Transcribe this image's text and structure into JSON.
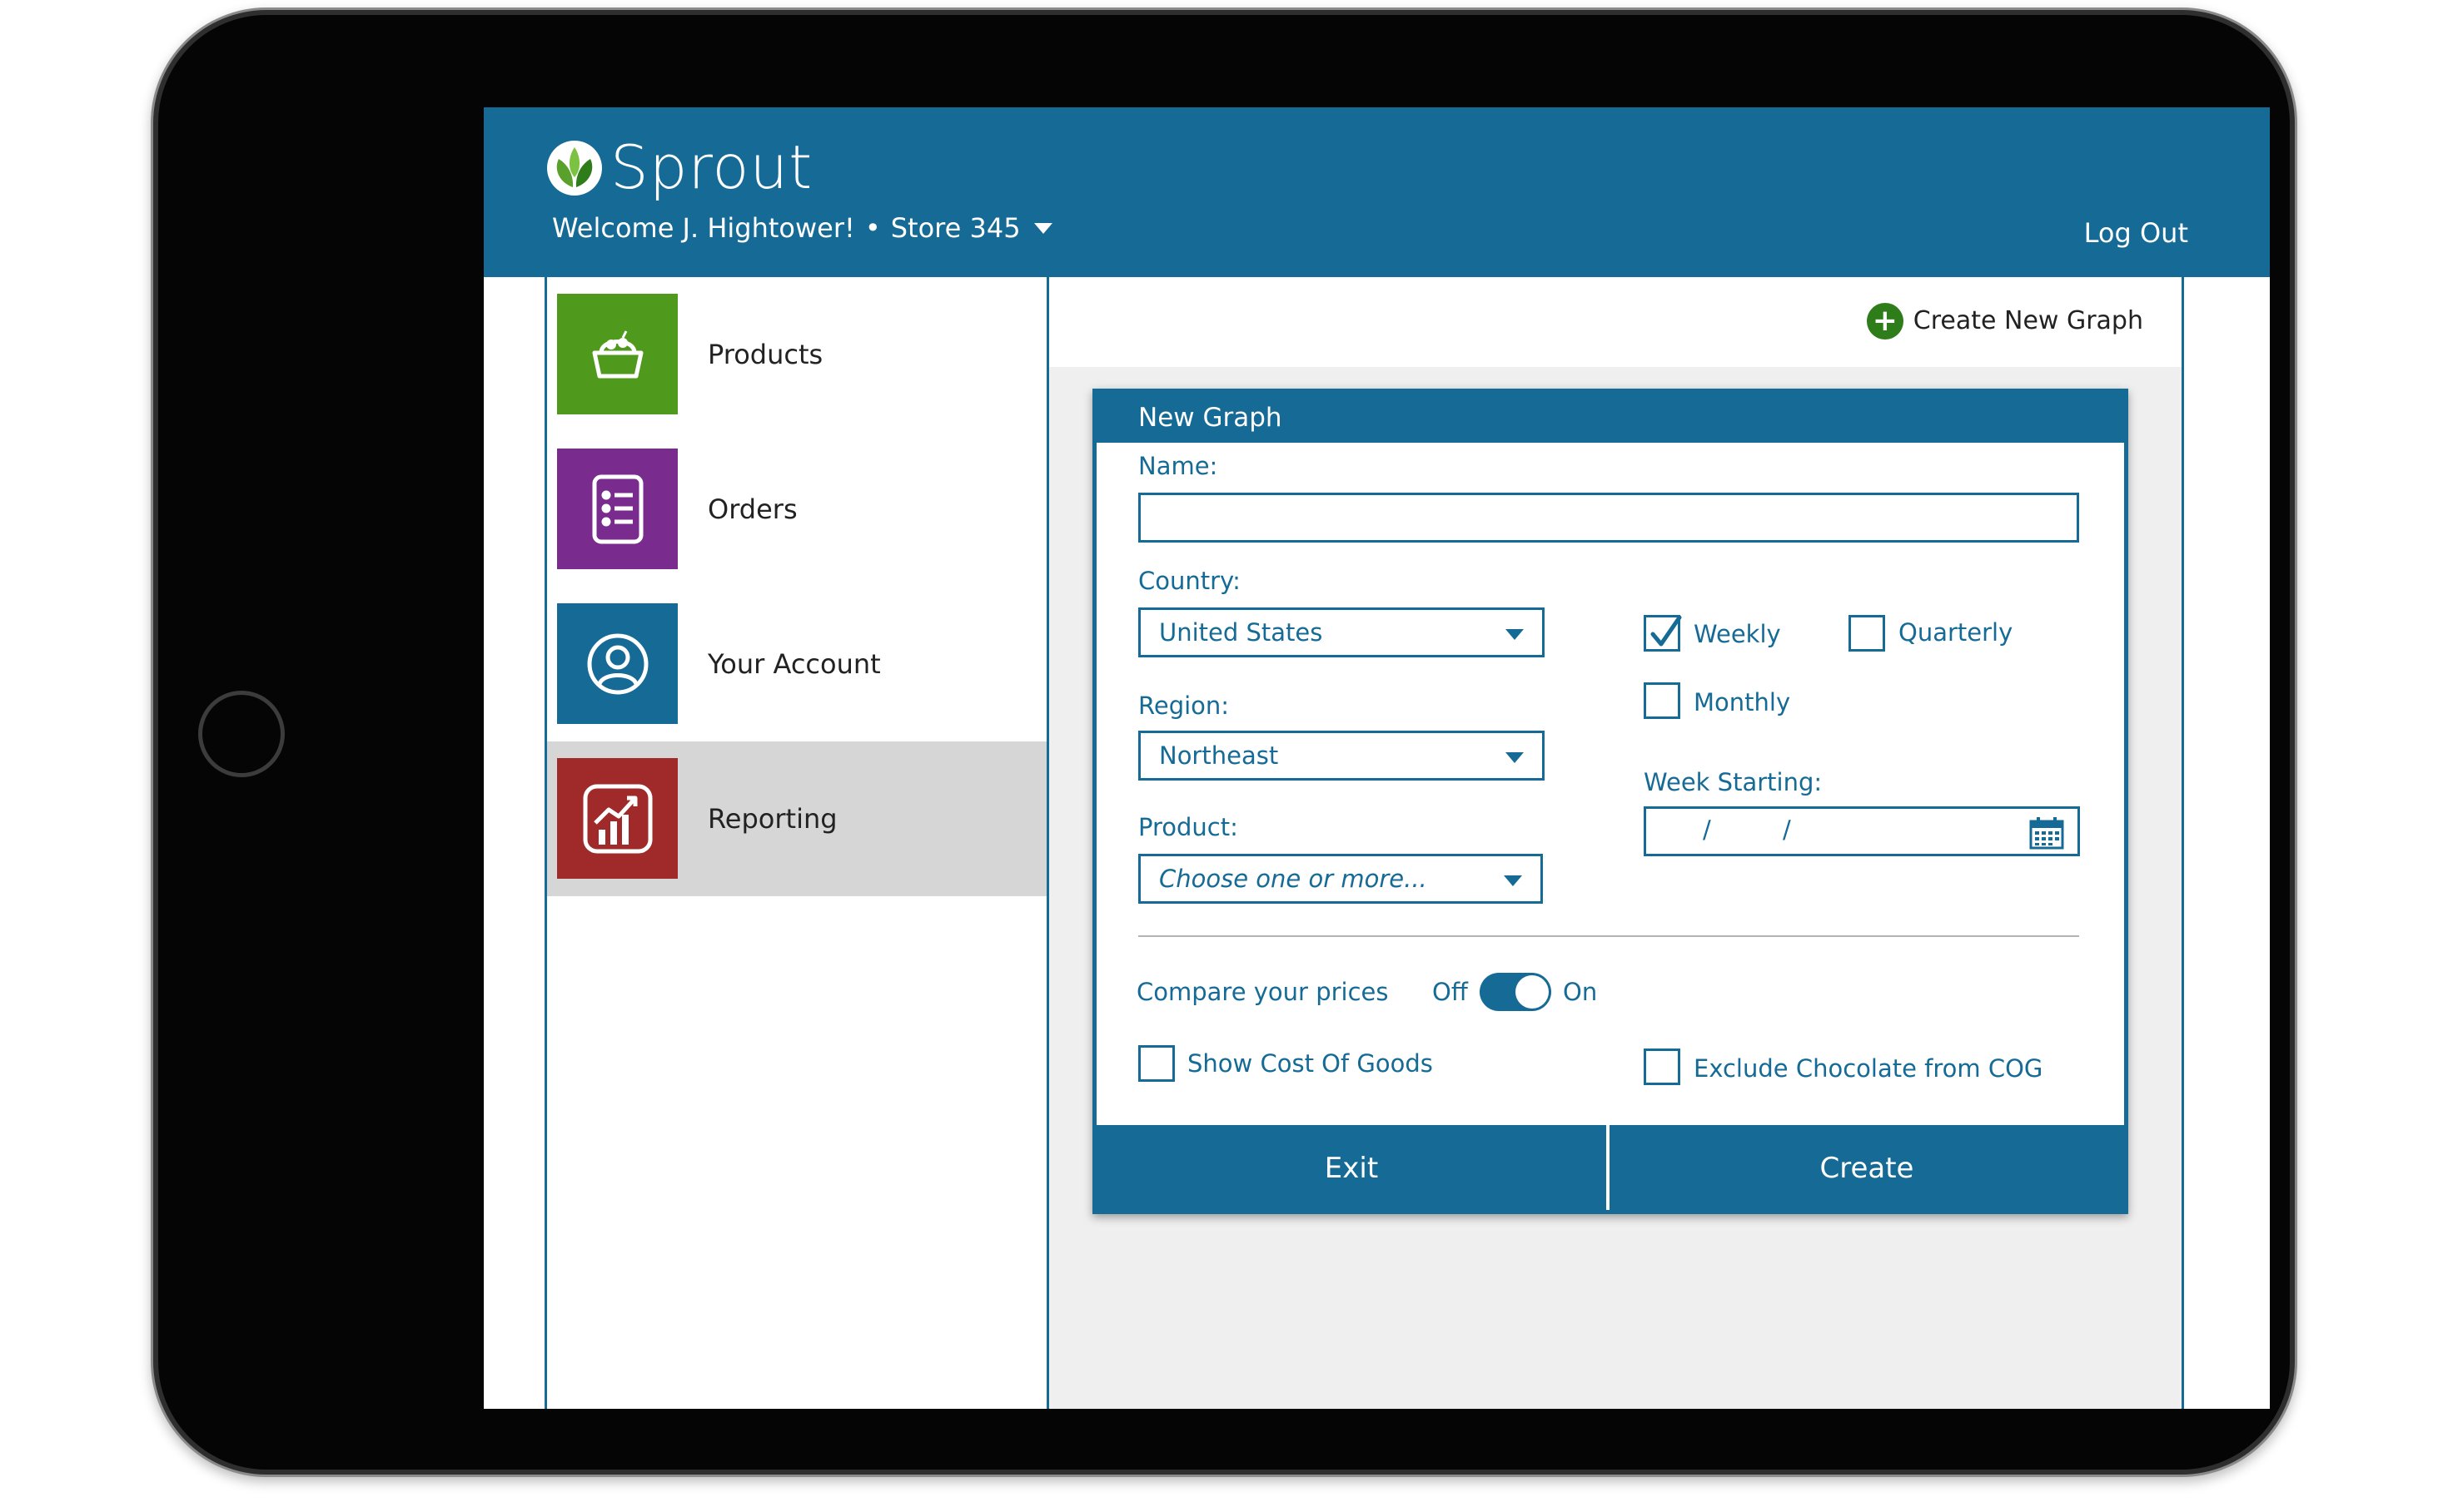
{
  "header": {
    "brand": "Sprout",
    "welcome": "Welcome J. Hightower!",
    "separator": "•",
    "store": "Store 345",
    "logout": "Log Out"
  },
  "sidebar": {
    "items": [
      {
        "label": "Products",
        "color": "#4f9a1c",
        "icon": "basket-icon"
      },
      {
        "label": "Orders",
        "color": "#7a2c8e",
        "icon": "list-icon"
      },
      {
        "label": "Your Account",
        "color": "#156a96",
        "icon": "user-icon"
      },
      {
        "label": "Reporting",
        "color": "#a02a2a",
        "icon": "chart-icon",
        "active": true
      }
    ]
  },
  "toolbar": {
    "create_new_graph": "Create New Graph"
  },
  "dialog": {
    "title": "New Graph",
    "name_label": "Name:",
    "name_value": "",
    "country_label": "Country:",
    "country_value": "United States",
    "region_label": "Region:",
    "region_value": "Northeast",
    "product_label": "Product:",
    "product_placeholder": "Choose one or more...",
    "frequency": {
      "weekly": {
        "label": "Weekly",
        "checked": true
      },
      "quarterly": {
        "label": "Quarterly",
        "checked": false
      },
      "monthly": {
        "label": "Monthly",
        "checked": false
      }
    },
    "week_starting_label": "Week Starting:",
    "date_separator": "/",
    "compare_label": "Compare your prices",
    "toggle_off": "Off",
    "toggle_on": "On",
    "toggle_state": "on",
    "show_cog": {
      "label": "Show Cost Of Goods",
      "checked": false
    },
    "exclude_chocolate": {
      "label": "Exclude Chocolate from COG",
      "checked": false
    },
    "exit_label": "Exit",
    "create_label": "Create"
  },
  "colors": {
    "primary": "#156a96",
    "accent_green": "#2e7d1a",
    "active_nav_bg": "#d6d6d6",
    "content_bg": "#efefef"
  }
}
